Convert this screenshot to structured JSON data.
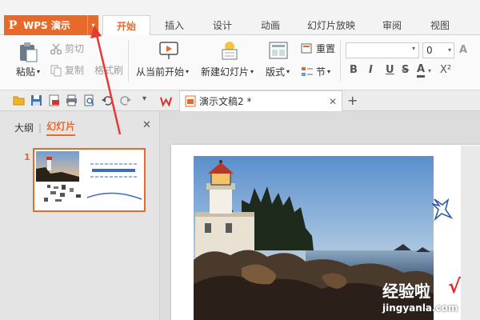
{
  "app": {
    "logo": "P",
    "name": "WPS 演示",
    "caret": "▾"
  },
  "tabs": [
    "开始",
    "插入",
    "设计",
    "动画",
    "幻灯片放映",
    "审阅",
    "视图"
  ],
  "ribbon": {
    "paste": "粘贴",
    "paste_caret": "▾",
    "cut": "剪切",
    "copy": "复制",
    "format_painter": "格式刷",
    "from_current": "从当前开始",
    "new_slide": "新建幻灯片",
    "layout": "版式",
    "reset": "重置",
    "section": "节",
    "font_size": "0",
    "format_buttons": [
      "B",
      "I",
      "U",
      "S",
      "A",
      "X²"
    ]
  },
  "document_tab": {
    "title": "演示文稿2 *",
    "close": "✕",
    "add": "+"
  },
  "left_panel": {
    "tab_outline": "大纲",
    "tab_slides": "幻灯片",
    "close": "✕",
    "slide_number": "1"
  },
  "watermark": {
    "text": "经验啦",
    "url": "jingyanla.com",
    "check": "√"
  },
  "colors": {
    "accent": "#e76a2b",
    "arrow": "#e53935"
  }
}
